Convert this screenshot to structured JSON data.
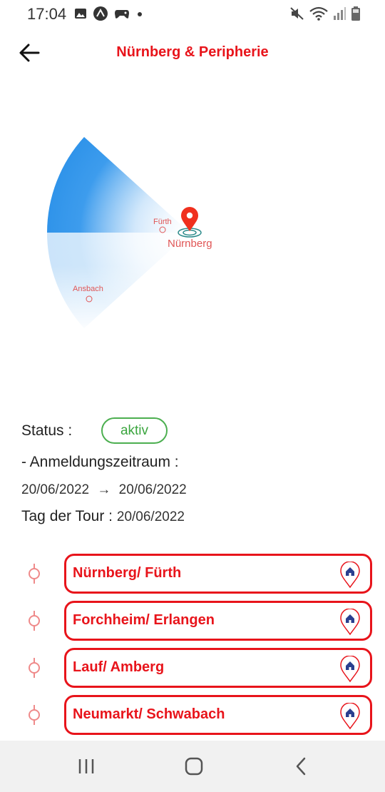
{
  "status_bar": {
    "time": "17:04",
    "left_icons": [
      "image-icon",
      "app-icon",
      "game-icon",
      "dot-icon"
    ],
    "right_icons": [
      "mute-icon",
      "wifi-icon",
      "signal-icon",
      "battery-icon"
    ]
  },
  "header": {
    "title": "Nürnberg & Peripherie",
    "back_icon": "arrow-left-icon",
    "accent_color": "#e8141b"
  },
  "map": {
    "main_city": "Nürnberg",
    "cities": [
      "Fürth",
      "Ansbach"
    ],
    "sector_color": "#2f96e8"
  },
  "info": {
    "status_label": "Status :",
    "status_value": "aktiv",
    "status_color": "#4caf50",
    "period_label": "- Anmeldungszeitraum :",
    "period_start": "20/06/2022",
    "arrow": "→",
    "period_end": "20/06/2022",
    "tour_label": "Tag der Tour :",
    "tour_date": "20/06/2022"
  },
  "stops": [
    {
      "name": "Nürnberg/ Fürth",
      "icon": "home-pin-icon"
    },
    {
      "name": "Forchheim/ Erlangen",
      "icon": "home-pin-icon"
    },
    {
      "name": "Lauf/ Amberg",
      "icon": "home-pin-icon"
    },
    {
      "name": "Neumarkt/ Schwabach",
      "icon": "home-pin-icon"
    }
  ],
  "nav_bar": {
    "buttons": [
      "recent-apps-icon",
      "home-icon",
      "back-icon"
    ]
  }
}
